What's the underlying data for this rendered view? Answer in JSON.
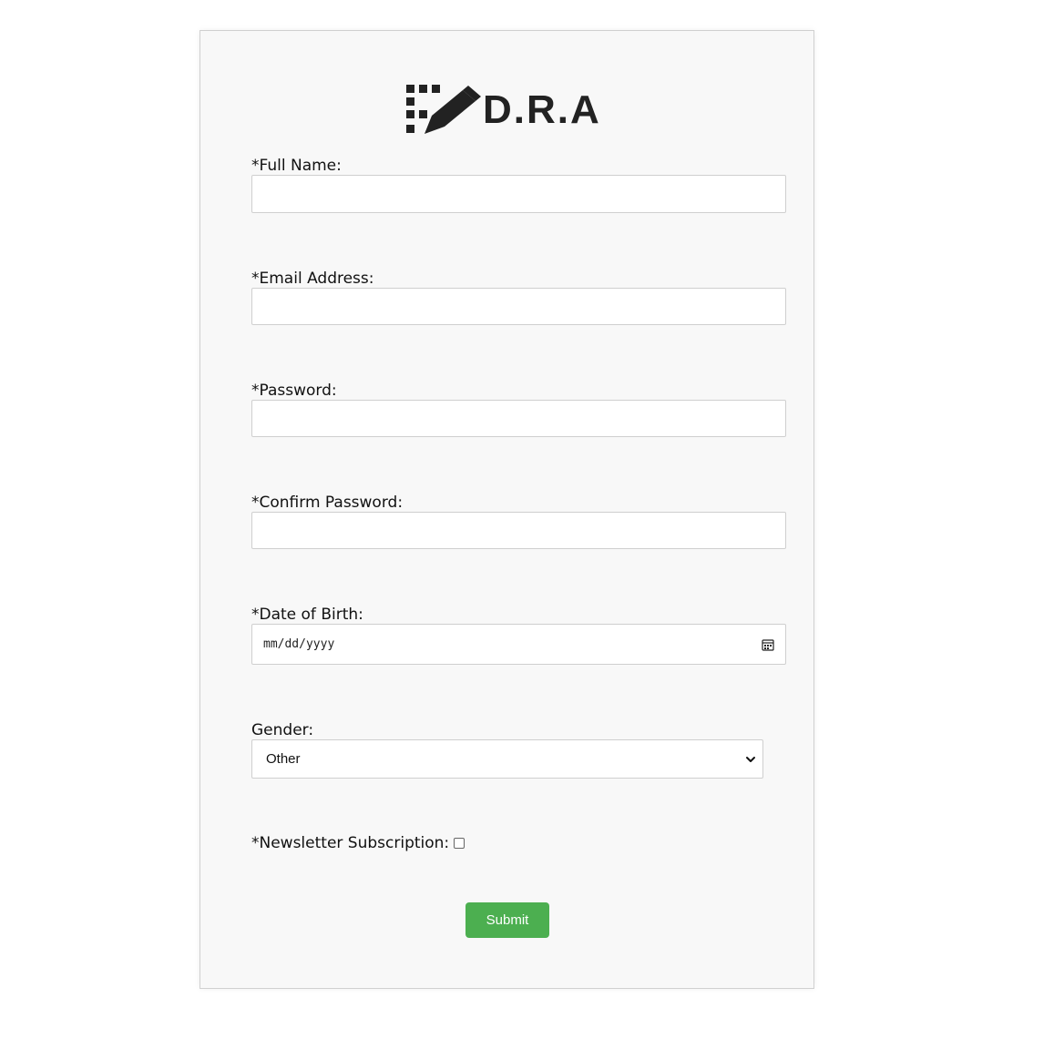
{
  "brand": {
    "logo_text": "D.R.A"
  },
  "form": {
    "full_name": {
      "label": "*Full Name:",
      "value": ""
    },
    "email": {
      "label": "*Email Address:",
      "value": ""
    },
    "password": {
      "label": "*Password:",
      "value": ""
    },
    "confirm_password": {
      "label": "*Confirm Password:",
      "value": ""
    },
    "dob": {
      "label": "*Date of Birth:",
      "placeholder": "mm/dd/yyyy",
      "icon": "calendar-icon"
    },
    "gender": {
      "label": "Gender:",
      "selected": "Other",
      "icon": "chevron-down-icon"
    },
    "newsletter": {
      "label": "*Newsletter Subscription:",
      "checked": false
    },
    "submit_label": "Submit"
  },
  "colors": {
    "accent": "#4caf50",
    "card_background": "#f8f8f8",
    "border": "#cfcfcf"
  }
}
